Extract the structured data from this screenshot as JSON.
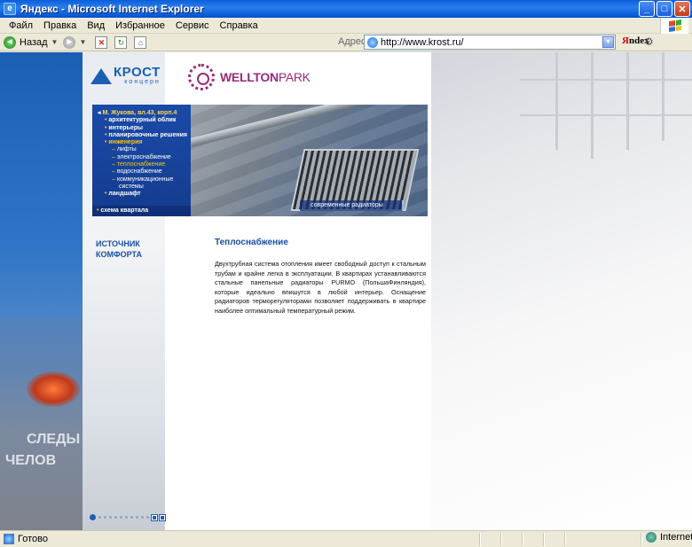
{
  "window": {
    "title": "Яндекс - Microsoft Internet Explorer"
  },
  "menu": [
    "Файл",
    "Правка",
    "Вид",
    "Избранное",
    "Сервис",
    "Справка"
  ],
  "toolbar": {
    "back_label": "Назад",
    "address_label": "Адрес:",
    "url": "http://www.krost.ru/",
    "yandex_y": "Я",
    "yandex_rest": "ndex"
  },
  "logos": {
    "krost": "КРОСТ",
    "krost_sub": "концерн",
    "wellton": "WELLTON",
    "wellton_park": "PARK"
  },
  "nav": {
    "header": "М. Жукова, вл.43, корп.4",
    "items": [
      {
        "label": "архитектурный облик",
        "level": 1
      },
      {
        "label": "интерьеры",
        "level": 1
      },
      {
        "label": "планировочные решения",
        "level": 1
      },
      {
        "label": "инженерия",
        "level": 1,
        "active": true
      },
      {
        "label": "лифты",
        "level": 2
      },
      {
        "label": "электроснабжение",
        "level": 2
      },
      {
        "label": "теплоснабжение",
        "level": 2,
        "active": true
      },
      {
        "label": "водоснабжение",
        "level": 2
      },
      {
        "label": "коммуникационные",
        "level": 2
      },
      {
        "label": "системы",
        "level": 2,
        "continuation": true
      },
      {
        "label": "ландшафт",
        "level": 1
      }
    ],
    "footer": "схема квартала"
  },
  "photo_caption": "современные радиаторы",
  "slogan": [
    "ИСТОЧНИК",
    "КОМФОРТА"
  ],
  "content": {
    "title": "Теплоснабжение",
    "body": "Двухтрубная система отопления имеет свободный доступ к стальным трубам и крайне легка в эксплуатации. В квартирах устанавливаются стальные панельные радиаторы PURMO (ПольшаФинляндия), которые идеально впишутся в любой интерьер. Оснащение радиаторов терморегуляторами позволяет поддерживать в квартире наиболее оптимальный температурный режим."
  },
  "decor_text": [
    "СЛЕДЫ",
    "ЧЕЛОВ"
  ],
  "status": {
    "text": "Готово",
    "zone": "Internet"
  }
}
